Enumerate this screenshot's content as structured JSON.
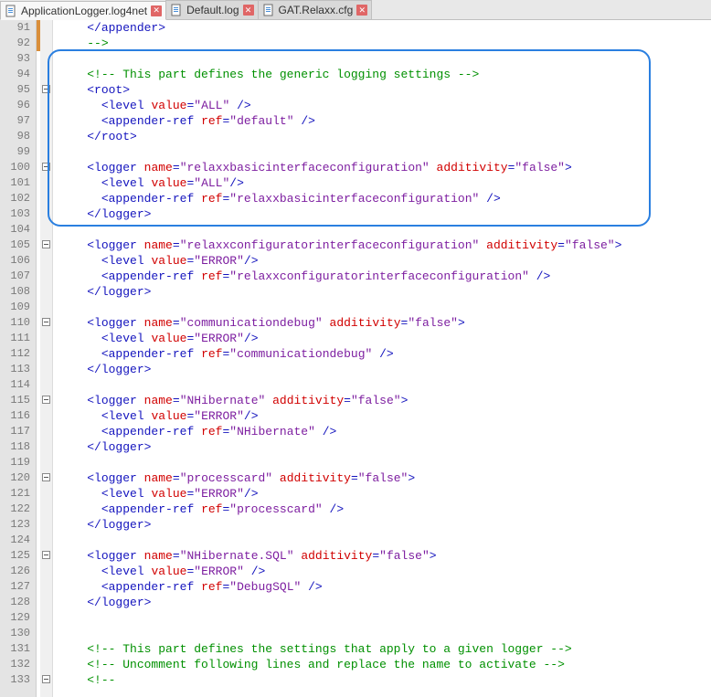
{
  "tabs": [
    {
      "label": "ApplicationLogger.log4net",
      "active": true,
      "iconColor": "#4a90d9"
    },
    {
      "label": "Default.log",
      "active": false,
      "iconColor": "#4a90d9"
    },
    {
      "label": "GAT.Relaxx.cfg",
      "active": false,
      "iconColor": "#4a90d9"
    }
  ],
  "firstLine": 91,
  "foldLines": [
    95,
    100,
    105,
    110,
    115,
    120,
    125,
    133
  ],
  "changedLines": [
    91,
    92
  ],
  "lines": [
    {
      "n": 91,
      "i": 2,
      "seg": [
        [
          "pun",
          "</"
        ],
        [
          "el",
          "appender"
        ],
        [
          "pun",
          ">"
        ]
      ]
    },
    {
      "n": 92,
      "i": 2,
      "seg": [
        [
          "cmt",
          "-->"
        ]
      ]
    },
    {
      "n": 93,
      "i": 0,
      "seg": []
    },
    {
      "n": 94,
      "i": 2,
      "seg": [
        [
          "cmt",
          "<!-- This part defines the generic logging settings -->"
        ]
      ]
    },
    {
      "n": 95,
      "i": 2,
      "seg": [
        [
          "pun",
          "<"
        ],
        [
          "el",
          "root"
        ],
        [
          "pun",
          ">"
        ]
      ]
    },
    {
      "n": 96,
      "i": 3,
      "seg": [
        [
          "pun",
          "<"
        ],
        [
          "el",
          "level"
        ],
        [
          "txt",
          " "
        ],
        [
          "attr",
          "value"
        ],
        [
          "pun",
          "="
        ],
        [
          "str",
          "\"ALL\""
        ],
        [
          "txt",
          " "
        ],
        [
          "pun",
          "/>"
        ]
      ]
    },
    {
      "n": 97,
      "i": 3,
      "seg": [
        [
          "pun",
          "<"
        ],
        [
          "el",
          "appender-ref"
        ],
        [
          "txt",
          " "
        ],
        [
          "attr",
          "ref"
        ],
        [
          "pun",
          "="
        ],
        [
          "str",
          "\"default\""
        ],
        [
          "txt",
          " "
        ],
        [
          "pun",
          "/>"
        ]
      ]
    },
    {
      "n": 98,
      "i": 2,
      "seg": [
        [
          "pun",
          "</"
        ],
        [
          "el",
          "root"
        ],
        [
          "pun",
          ">"
        ]
      ]
    },
    {
      "n": 99,
      "i": 0,
      "seg": []
    },
    {
      "n": 100,
      "i": 2,
      "seg": [
        [
          "pun",
          "<"
        ],
        [
          "el",
          "logger"
        ],
        [
          "txt",
          " "
        ],
        [
          "attr",
          "name"
        ],
        [
          "pun",
          "="
        ],
        [
          "str",
          "\"relaxxbasicinterfaceconfiguration\""
        ],
        [
          "txt",
          " "
        ],
        [
          "attr",
          "additivity"
        ],
        [
          "pun",
          "="
        ],
        [
          "str",
          "\"false\""
        ],
        [
          "pun",
          ">"
        ]
      ]
    },
    {
      "n": 101,
      "i": 3,
      "seg": [
        [
          "pun",
          "<"
        ],
        [
          "el",
          "level"
        ],
        [
          "txt",
          " "
        ],
        [
          "attr",
          "value"
        ],
        [
          "pun",
          "="
        ],
        [
          "str",
          "\"ALL\""
        ],
        [
          "pun",
          "/>"
        ]
      ]
    },
    {
      "n": 102,
      "i": 3,
      "seg": [
        [
          "pun",
          "<"
        ],
        [
          "el",
          "appender-ref"
        ],
        [
          "txt",
          " "
        ],
        [
          "attr",
          "ref"
        ],
        [
          "pun",
          "="
        ],
        [
          "str",
          "\"relaxxbasicinterfaceconfiguration\""
        ],
        [
          "txt",
          " "
        ],
        [
          "pun",
          "/>"
        ]
      ]
    },
    {
      "n": 103,
      "i": 2,
      "seg": [
        [
          "pun",
          "</"
        ],
        [
          "el",
          "logger"
        ],
        [
          "pun",
          ">"
        ]
      ]
    },
    {
      "n": 104,
      "i": 0,
      "seg": []
    },
    {
      "n": 105,
      "i": 2,
      "seg": [
        [
          "pun",
          "<"
        ],
        [
          "el",
          "logger"
        ],
        [
          "txt",
          " "
        ],
        [
          "attr",
          "name"
        ],
        [
          "pun",
          "="
        ],
        [
          "str",
          "\"relaxxconfiguratorinterfaceconfiguration\""
        ],
        [
          "txt",
          " "
        ],
        [
          "attr",
          "additivity"
        ],
        [
          "pun",
          "="
        ],
        [
          "str",
          "\"false\""
        ],
        [
          "pun",
          ">"
        ]
      ]
    },
    {
      "n": 106,
      "i": 3,
      "seg": [
        [
          "pun",
          "<"
        ],
        [
          "el",
          "level"
        ],
        [
          "txt",
          " "
        ],
        [
          "attr",
          "value"
        ],
        [
          "pun",
          "="
        ],
        [
          "str",
          "\"ERROR\""
        ],
        [
          "pun",
          "/>"
        ]
      ]
    },
    {
      "n": 107,
      "i": 3,
      "seg": [
        [
          "pun",
          "<"
        ],
        [
          "el",
          "appender-ref"
        ],
        [
          "txt",
          " "
        ],
        [
          "attr",
          "ref"
        ],
        [
          "pun",
          "="
        ],
        [
          "str",
          "\"relaxxconfiguratorinterfaceconfiguration\""
        ],
        [
          "txt",
          " "
        ],
        [
          "pun",
          "/>"
        ]
      ]
    },
    {
      "n": 108,
      "i": 2,
      "seg": [
        [
          "pun",
          "</"
        ],
        [
          "el",
          "logger"
        ],
        [
          "pun",
          ">"
        ]
      ]
    },
    {
      "n": 109,
      "i": 0,
      "seg": []
    },
    {
      "n": 110,
      "i": 2,
      "seg": [
        [
          "pun",
          "<"
        ],
        [
          "el",
          "logger"
        ],
        [
          "txt",
          " "
        ],
        [
          "attr",
          "name"
        ],
        [
          "pun",
          "="
        ],
        [
          "str",
          "\"communicationdebug\""
        ],
        [
          "txt",
          " "
        ],
        [
          "attr",
          "additivity"
        ],
        [
          "pun",
          "="
        ],
        [
          "str",
          "\"false\""
        ],
        [
          "pun",
          ">"
        ]
      ]
    },
    {
      "n": 111,
      "i": 3,
      "seg": [
        [
          "pun",
          "<"
        ],
        [
          "el",
          "level"
        ],
        [
          "txt",
          " "
        ],
        [
          "attr",
          "value"
        ],
        [
          "pun",
          "="
        ],
        [
          "str",
          "\"ERROR\""
        ],
        [
          "pun",
          "/>"
        ]
      ]
    },
    {
      "n": 112,
      "i": 3,
      "seg": [
        [
          "pun",
          "<"
        ],
        [
          "el",
          "appender-ref"
        ],
        [
          "txt",
          " "
        ],
        [
          "attr",
          "ref"
        ],
        [
          "pun",
          "="
        ],
        [
          "str",
          "\"communicationdebug\""
        ],
        [
          "txt",
          " "
        ],
        [
          "pun",
          "/>"
        ]
      ]
    },
    {
      "n": 113,
      "i": 2,
      "seg": [
        [
          "pun",
          "</"
        ],
        [
          "el",
          "logger"
        ],
        [
          "pun",
          ">"
        ]
      ]
    },
    {
      "n": 114,
      "i": 0,
      "seg": []
    },
    {
      "n": 115,
      "i": 2,
      "seg": [
        [
          "pun",
          "<"
        ],
        [
          "el",
          "logger"
        ],
        [
          "txt",
          " "
        ],
        [
          "attr",
          "name"
        ],
        [
          "pun",
          "="
        ],
        [
          "str",
          "\"NHibernate\""
        ],
        [
          "txt",
          " "
        ],
        [
          "attr",
          "additivity"
        ],
        [
          "pun",
          "="
        ],
        [
          "str",
          "\"false\""
        ],
        [
          "pun",
          ">"
        ]
      ]
    },
    {
      "n": 116,
      "i": 3,
      "seg": [
        [
          "pun",
          "<"
        ],
        [
          "el",
          "level"
        ],
        [
          "txt",
          " "
        ],
        [
          "attr",
          "value"
        ],
        [
          "pun",
          "="
        ],
        [
          "str",
          "\"ERROR\""
        ],
        [
          "pun",
          "/>"
        ]
      ]
    },
    {
      "n": 117,
      "i": 3,
      "seg": [
        [
          "pun",
          "<"
        ],
        [
          "el",
          "appender-ref"
        ],
        [
          "txt",
          " "
        ],
        [
          "attr",
          "ref"
        ],
        [
          "pun",
          "="
        ],
        [
          "str",
          "\"NHibernate\""
        ],
        [
          "txt",
          " "
        ],
        [
          "pun",
          "/>"
        ]
      ]
    },
    {
      "n": 118,
      "i": 2,
      "seg": [
        [
          "pun",
          "</"
        ],
        [
          "el",
          "logger"
        ],
        [
          "pun",
          ">"
        ]
      ]
    },
    {
      "n": 119,
      "i": 0,
      "seg": []
    },
    {
      "n": 120,
      "i": 2,
      "seg": [
        [
          "pun",
          "<"
        ],
        [
          "el",
          "logger"
        ],
        [
          "txt",
          " "
        ],
        [
          "attr",
          "name"
        ],
        [
          "pun",
          "="
        ],
        [
          "str",
          "\"processcard\""
        ],
        [
          "txt",
          " "
        ],
        [
          "attr",
          "additivity"
        ],
        [
          "pun",
          "="
        ],
        [
          "str",
          "\"false\""
        ],
        [
          "pun",
          ">"
        ]
      ]
    },
    {
      "n": 121,
      "i": 3,
      "seg": [
        [
          "pun",
          "<"
        ],
        [
          "el",
          "level"
        ],
        [
          "txt",
          " "
        ],
        [
          "attr",
          "value"
        ],
        [
          "pun",
          "="
        ],
        [
          "str",
          "\"ERROR\""
        ],
        [
          "pun",
          "/>"
        ]
      ]
    },
    {
      "n": 122,
      "i": 3,
      "seg": [
        [
          "pun",
          "<"
        ],
        [
          "el",
          "appender-ref"
        ],
        [
          "txt",
          " "
        ],
        [
          "attr",
          "ref"
        ],
        [
          "pun",
          "="
        ],
        [
          "str",
          "\"processcard\""
        ],
        [
          "txt",
          " "
        ],
        [
          "pun",
          "/>"
        ]
      ]
    },
    {
      "n": 123,
      "i": 2,
      "seg": [
        [
          "pun",
          "</"
        ],
        [
          "el",
          "logger"
        ],
        [
          "pun",
          ">"
        ]
      ]
    },
    {
      "n": 124,
      "i": 0,
      "seg": []
    },
    {
      "n": 125,
      "i": 2,
      "seg": [
        [
          "pun",
          "<"
        ],
        [
          "el",
          "logger"
        ],
        [
          "txt",
          " "
        ],
        [
          "attr",
          "name"
        ],
        [
          "pun",
          "="
        ],
        [
          "str",
          "\"NHibernate.SQL\""
        ],
        [
          "txt",
          " "
        ],
        [
          "attr",
          "additivity"
        ],
        [
          "pun",
          "="
        ],
        [
          "str",
          "\"false\""
        ],
        [
          "pun",
          ">"
        ]
      ]
    },
    {
      "n": 126,
      "i": 3,
      "seg": [
        [
          "pun",
          "<"
        ],
        [
          "el",
          "level"
        ],
        [
          "txt",
          " "
        ],
        [
          "attr",
          "value"
        ],
        [
          "pun",
          "="
        ],
        [
          "str",
          "\"ERROR\""
        ],
        [
          "txt",
          " "
        ],
        [
          "pun",
          "/>"
        ]
      ]
    },
    {
      "n": 127,
      "i": 3,
      "seg": [
        [
          "pun",
          "<"
        ],
        [
          "el",
          "appender-ref"
        ],
        [
          "txt",
          " "
        ],
        [
          "attr",
          "ref"
        ],
        [
          "pun",
          "="
        ],
        [
          "str",
          "\"DebugSQL\""
        ],
        [
          "txt",
          " "
        ],
        [
          "pun",
          "/>"
        ]
      ]
    },
    {
      "n": 128,
      "i": 2,
      "seg": [
        [
          "pun",
          "</"
        ],
        [
          "el",
          "logger"
        ],
        [
          "pun",
          ">"
        ]
      ]
    },
    {
      "n": 129,
      "i": 0,
      "seg": []
    },
    {
      "n": 130,
      "i": 0,
      "seg": []
    },
    {
      "n": 131,
      "i": 2,
      "seg": [
        [
          "cmt",
          "<!-- This part defines the settings that apply to a given logger -->"
        ]
      ]
    },
    {
      "n": 132,
      "i": 2,
      "seg": [
        [
          "cmt",
          "<!-- Uncomment following lines and replace the name to activate -->"
        ]
      ]
    },
    {
      "n": 133,
      "i": 2,
      "seg": [
        [
          "cmt",
          "<!--"
        ]
      ]
    }
  ]
}
